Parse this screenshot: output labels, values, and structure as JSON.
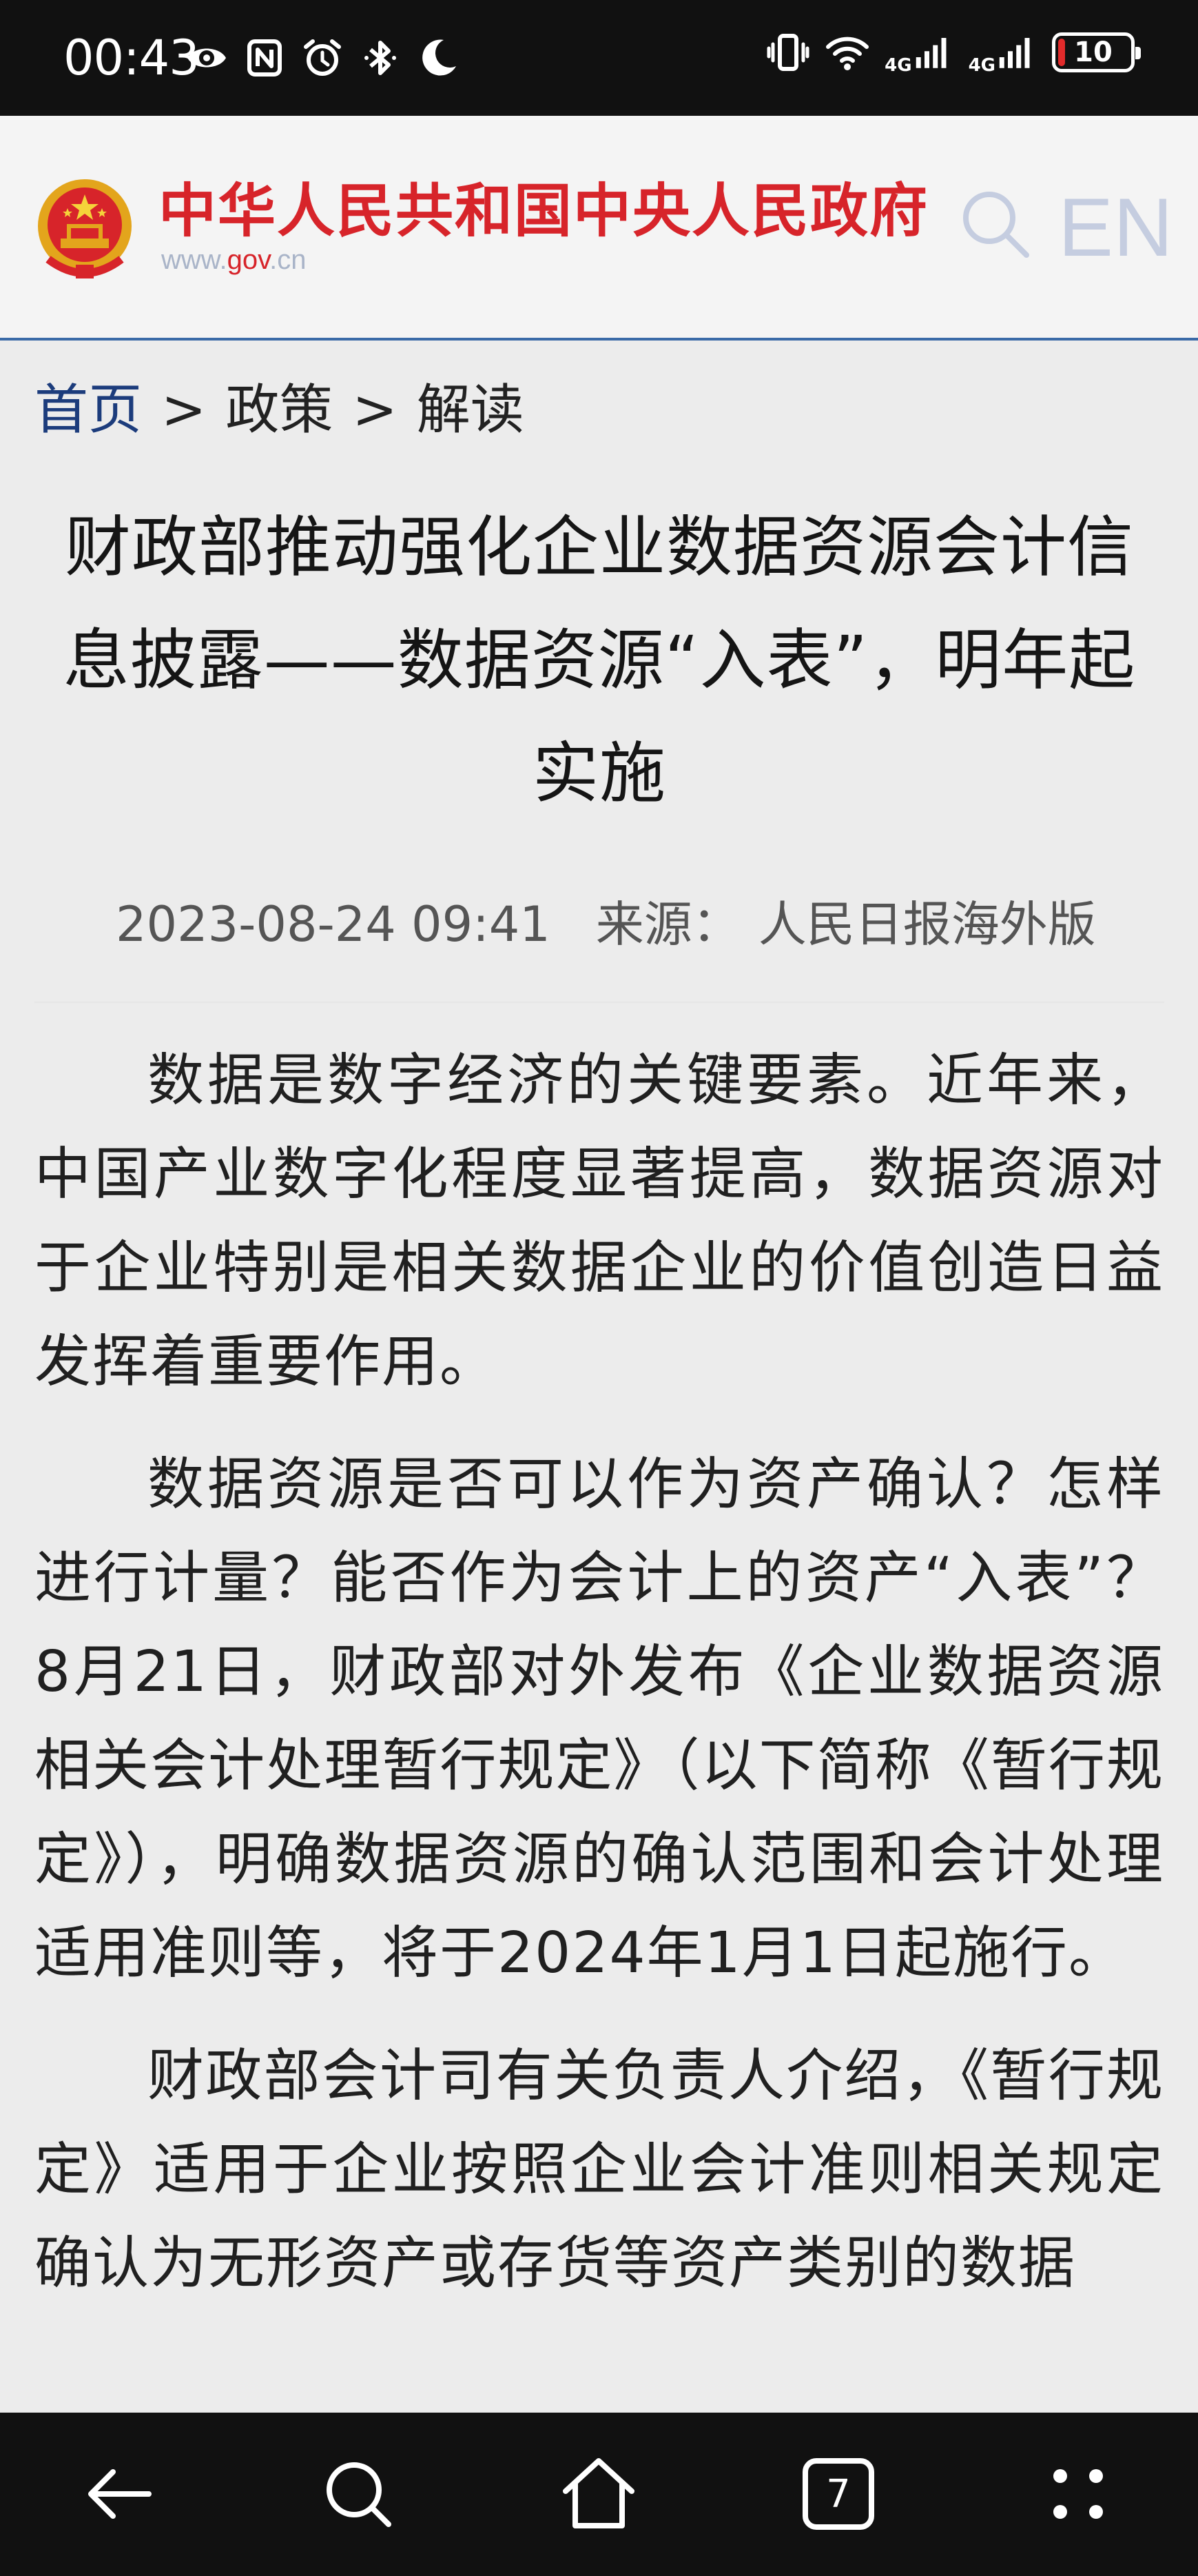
{
  "status_bar": {
    "time": "00:43",
    "network_1": "4G",
    "network_2": "4G",
    "battery_level": 10,
    "battery_text": "10",
    "icons": [
      "eye-icon",
      "nfc-icon",
      "alarm-icon",
      "bluetooth-icon",
      "moon-icon",
      "vibrate-icon",
      "wifi-icon",
      "signal-icon",
      "battery-icon"
    ]
  },
  "header": {
    "site_name": "中华人民共和国中央人民政府",
    "domain_prefix": "www.",
    "domain_mid": "gov",
    "domain_suffix": ".cn",
    "lang_label": "EN",
    "brand_color": "#d7242a",
    "accent_color": "#3a6aa7"
  },
  "breadcrumb": {
    "home": "首页",
    "sep": ">",
    "level1": "政策",
    "level2": "解读"
  },
  "article": {
    "title": "财政部推动强化企业数据资源会计信息披露——数据资源“入表”，明年起实施",
    "date": "2023-08-24 09:41",
    "source_label": "来源：",
    "source": "人民日报海外版",
    "paragraphs": [
      "数据是数字经济的关键要素。近年来，中国产业数字化程度显著提高，数据资源对于企业特别是相关数据企业的价值创造日益发挥着重要作用。",
      "数据资源是否可以作为资产确认？怎样进行计量？能否作为会计上的资产“入表”？8月21日，财政部对外发布《企业数据资源相关会计处理暂行规定》（以下简称《暂行规定》），明确数据资源的确认范围和会计处理适用准则等，将于2024年1月1日起施行。",
      "财政部会计司有关负责人介绍，《暂行规定》适用于企业按照企业会计准则相关规定确认为无形资产或存货等资产类别的数据"
    ]
  },
  "nav_bar": {
    "tab_count": "7",
    "buttons": [
      "back-icon",
      "search-icon",
      "home-icon",
      "tabs-icon",
      "menu-icon"
    ]
  }
}
